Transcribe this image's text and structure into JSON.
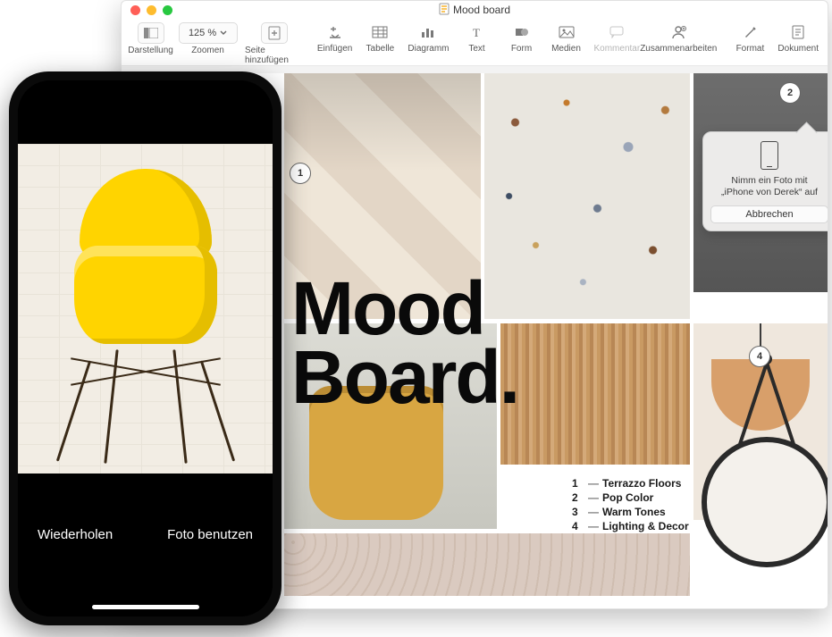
{
  "window": {
    "title": "Mood board",
    "traffic_lights": [
      "close",
      "minimize",
      "zoom"
    ]
  },
  "toolbar": {
    "view_label": "Darstellung",
    "zoom_value": "125 %",
    "zoom_label": "Zoomen",
    "add_page_label": "Seite hinzufügen",
    "insert_label": "Einfügen",
    "table_label": "Tabelle",
    "chart_label": "Diagramm",
    "text_label": "Text",
    "shape_label": "Form",
    "media_label": "Medien",
    "comment_label": "Kommentar",
    "collaborate_label": "Zusammenarbeiten",
    "format_label": "Format",
    "document_label": "Dokument"
  },
  "document": {
    "title_line1": "Mood",
    "title_line2": "Board.",
    "annotation_1": "1",
    "annotation_2": "2",
    "annotation_4": "4",
    "legend": [
      {
        "num": "1",
        "label": "Terrazzo Floors"
      },
      {
        "num": "2",
        "label": "Pop Color"
      },
      {
        "num": "3",
        "label": "Warm Tones"
      },
      {
        "num": "4",
        "label": "Lighting & Decor"
      }
    ]
  },
  "popover": {
    "caption_line1": "Nimm ein Foto mit",
    "caption_line2": "„iPhone von Derek“ auf",
    "cancel_label": "Abbrechen"
  },
  "iphone": {
    "retake_label": "Wiederholen",
    "use_photo_label": "Foto benutzen"
  }
}
